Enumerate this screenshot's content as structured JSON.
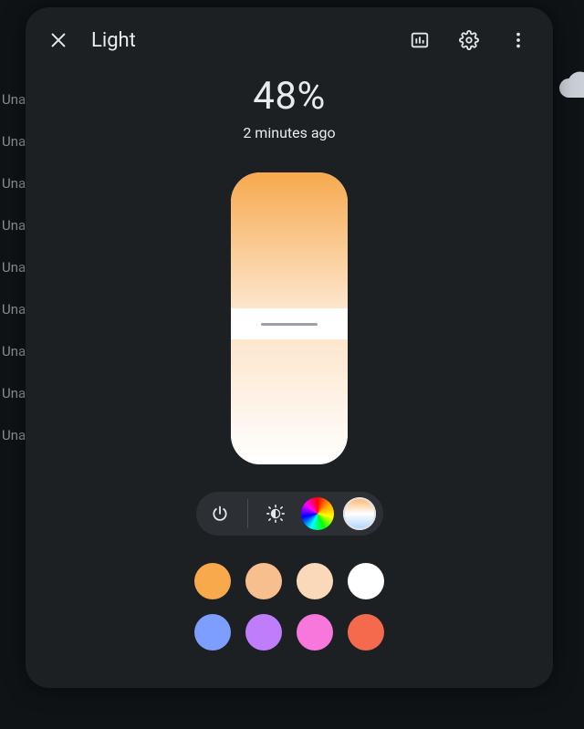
{
  "background_items": [
    "Una",
    "Una",
    "Una",
    "Una",
    "Una",
    "Una",
    "Una",
    "Una",
    "Una"
  ],
  "header": {
    "title": "Light"
  },
  "brightness": {
    "percent_label": "48%",
    "percent": 48,
    "timestamp": "2 minutes ago"
  },
  "modes": {
    "selected_index": 3,
    "items": [
      "power",
      "brightness",
      "color",
      "color-temperature"
    ]
  },
  "swatches": [
    {
      "name": "orange",
      "color": "#f7a94c"
    },
    {
      "name": "peach",
      "color": "#f8bf8e"
    },
    {
      "name": "light-peach",
      "color": "#fad9bb"
    },
    {
      "name": "white",
      "color": "#ffffff"
    },
    {
      "name": "periwinkle",
      "color": "#7d9dff"
    },
    {
      "name": "lavender",
      "color": "#c07dfb"
    },
    {
      "name": "pink",
      "color": "#f877dc"
    },
    {
      "name": "coral",
      "color": "#f56a4d"
    }
  ],
  "theme": {
    "slider_top_color": "#f7a94e",
    "slider_mid_color": "#fde6cd",
    "card_bg": "#1d2023"
  }
}
